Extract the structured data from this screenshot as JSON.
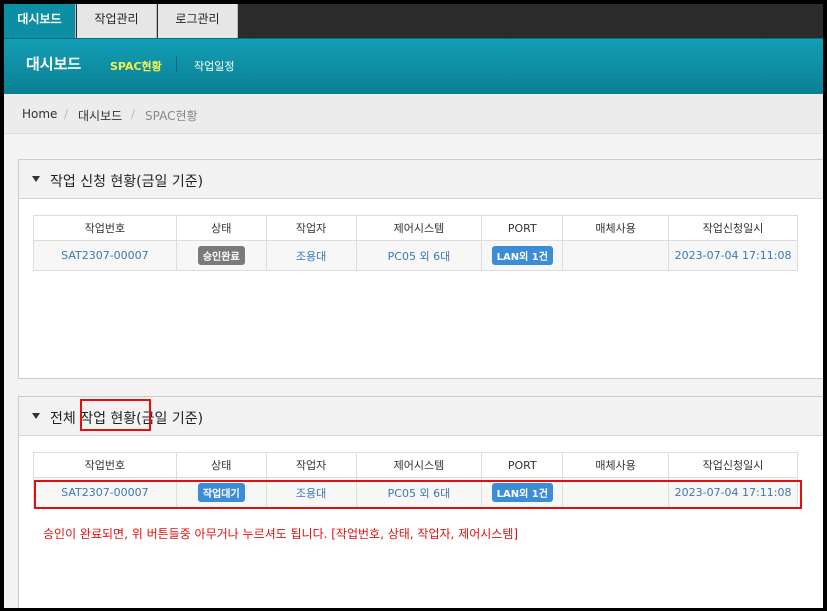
{
  "tabs": [
    "대시보드",
    "작업관리",
    "로그관리"
  ],
  "nav": {
    "title": "대시보드",
    "items": [
      "SPAC현황",
      "작업일정"
    ]
  },
  "breadcrumb": [
    "Home",
    "대시보드",
    "SPAC현황"
  ],
  "panel1": {
    "title": "작업 신청 현황(금일 기준)",
    "columns": [
      "작업번호",
      "상태",
      "작업자",
      "제어시스템",
      "PORT",
      "매체사용",
      "작업신청일시"
    ],
    "row": {
      "job_no": "SAT2307-00007",
      "status": "승인완료",
      "worker": "조용대",
      "system": "PC05 외 6대",
      "port": "LAN외 1건",
      "media": "",
      "requested_at": "2023-07-04 17:11:08"
    }
  },
  "panel2": {
    "title": "전체 작업 현황(금일 기준)",
    "columns": [
      "작업번호",
      "상태",
      "작업자",
      "제어시스템",
      "PORT",
      "매체사용",
      "작업신청일시"
    ],
    "row": {
      "job_no": "SAT2307-00007",
      "status": "작업대기",
      "worker": "조용대",
      "system": "PC05 외 6대",
      "port": "LAN외 1건",
      "media": "",
      "requested_at": "2023-07-04 17:11:08"
    },
    "note": "승인이 완료되면, 위 버튼들중 아무거나 누르셔도 됩니다. [작업번호, 상태, 작업자, 제어시스템]"
  },
  "colors": {
    "accent": "#0c8fa4",
    "highlight": "#e01010",
    "badge_gray": "#7a7a7a",
    "badge_blue": "#3b8ed6"
  }
}
